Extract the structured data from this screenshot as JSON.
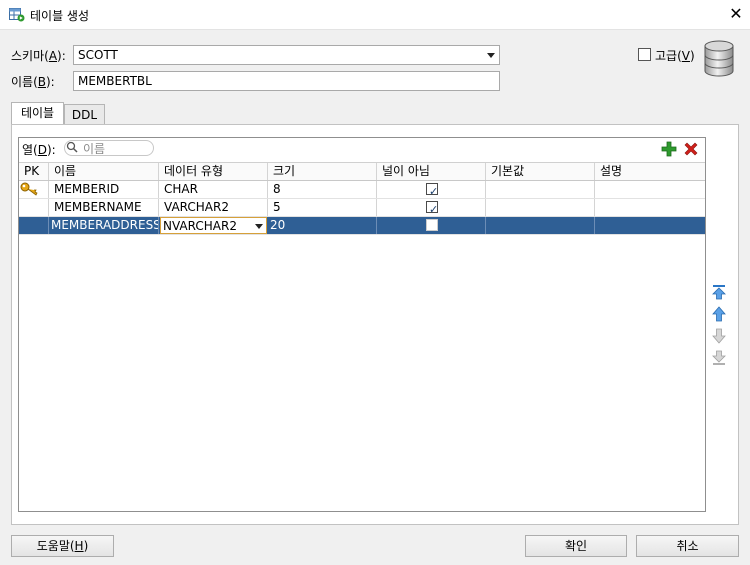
{
  "window": {
    "title": "테이블 생성",
    "close_glyph": "✕"
  },
  "schema": {
    "label_pre": "스키마(",
    "label_key": "A",
    "label_post": "):",
    "value": "SCOTT"
  },
  "name": {
    "label_pre": "이름(",
    "label_key": "B",
    "label_post": "):",
    "value": "MEMBERTBL"
  },
  "advanced": {
    "label_pre": "고급(",
    "label_key": "V",
    "label_post": ")",
    "checked": false
  },
  "tabs": [
    {
      "label": "테이블",
      "active": true
    },
    {
      "label": "DDL",
      "active": false
    }
  ],
  "columns_filter": {
    "label_pre": "열(",
    "label_key": "D",
    "label_post": "):",
    "placeholder": "이름"
  },
  "table": {
    "headers": [
      "PK",
      "이름",
      "데이터 유형",
      "크기",
      "널이 아님",
      "기본값",
      "설명"
    ],
    "rows": [
      {
        "pk": true,
        "name": "MEMBERID",
        "type": "CHAR",
        "size": "8",
        "not_null": true,
        "default": "",
        "desc": ""
      },
      {
        "pk": false,
        "name": "MEMBERNAME",
        "type": "VARCHAR2",
        "size": "5",
        "not_null": true,
        "default": "",
        "desc": ""
      },
      {
        "pk": false,
        "name": "MEMBERADDRESS",
        "type": "NVARCHAR2",
        "size": "20",
        "not_null": false,
        "default": "",
        "desc": "",
        "selected": true
      }
    ]
  },
  "buttons": {
    "help_pre": "도움말(",
    "help_key": "H",
    "help_post": ")",
    "ok": "확인",
    "cancel": "취소"
  },
  "colors": {
    "selection": "#2f5f95",
    "add_icon": "#2e9a2e",
    "delete_icon": "#d0201a",
    "arrow_icon": "#2a76c6"
  }
}
